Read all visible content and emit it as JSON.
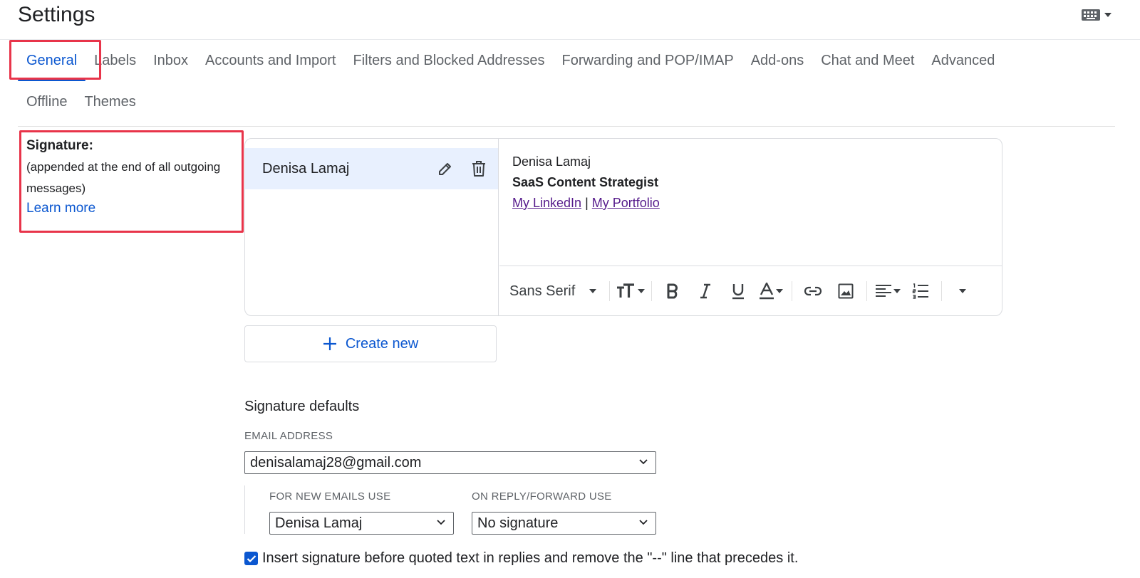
{
  "header": {
    "title": "Settings",
    "keyboard_icon": "keyboard-icon"
  },
  "tabs": {
    "row1": [
      "General",
      "Labels",
      "Inbox",
      "Accounts and Import",
      "Filters and Blocked Addresses",
      "Forwarding and POP/IMAP",
      "Add-ons",
      "Chat and Meet",
      "Advanced"
    ],
    "row2": [
      "Offline",
      "Themes"
    ],
    "active": "General"
  },
  "signature": {
    "heading": "Signature:",
    "description": "(appended at the end of all outgoing messages)",
    "learn_more": "Learn more",
    "items": [
      {
        "name": "Denisa Lamaj"
      }
    ],
    "editor": {
      "line1": "Denisa Lamaj",
      "line2": "SaaS Content Strategist",
      "link1": "My LinkedIn",
      "separator": "|",
      "link2": "My Portfolio"
    },
    "toolbar": {
      "font": "Sans Serif",
      "icons": [
        "text-size-icon",
        "bold-icon",
        "italic-icon",
        "underline-icon",
        "text-color-icon",
        "link-icon",
        "image-icon",
        "align-icon",
        "numbered-list-icon",
        "more-options-icon"
      ]
    },
    "create_new": "Create new"
  },
  "defaults": {
    "title": "Signature defaults",
    "email_label": "EMAIL ADDRESS",
    "email_value": "denisalamaj28@gmail.com",
    "new_emails_label": "FOR NEW EMAILS USE",
    "new_emails_value": "Denisa Lamaj",
    "reply_label": "ON REPLY/FORWARD USE",
    "reply_value": "No signature",
    "checkbox_label": "Insert signature before quoted text in replies and remove the \"--\" line that precedes it.",
    "checkbox_checked": true
  },
  "colors": {
    "accent": "#0b57d0",
    "highlight": "#e8344a",
    "selected_bg": "#e8f0fe",
    "visited_link": "#551a8b"
  }
}
